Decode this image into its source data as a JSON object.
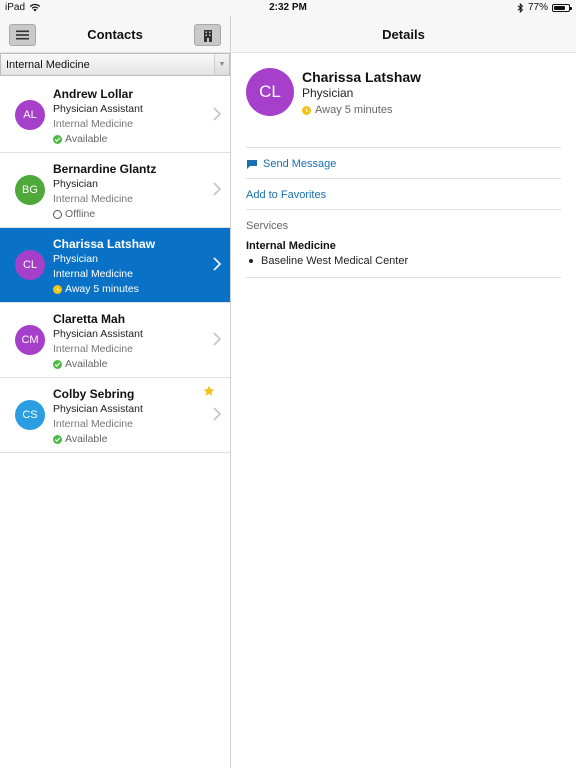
{
  "status_bar": {
    "device": "iPad",
    "time": "2:32 PM",
    "battery": "77%",
    "battery_level": 0.77
  },
  "left": {
    "title": "Contacts",
    "filter_value": "Internal Medicine",
    "contacts": [
      {
        "initials": "AL",
        "name": "Andrew Lollar",
        "role": "Physician Assistant",
        "dept": "Internal Medicine",
        "status": "Available",
        "status_kind": "available",
        "avatar_color": "#a63fc9",
        "favorite": false,
        "selected": false
      },
      {
        "initials": "BG",
        "name": "Bernardine Glantz",
        "role": "Physician",
        "dept": "Internal Medicine",
        "status": "Offline",
        "status_kind": "offline",
        "avatar_color": "#4ea93a",
        "favorite": false,
        "selected": false
      },
      {
        "initials": "CL",
        "name": "Charissa Latshaw",
        "role": "Physician",
        "dept": "Internal Medicine",
        "status": "Away 5 minutes",
        "status_kind": "away",
        "avatar_color": "#a63fc9",
        "favorite": false,
        "selected": true
      },
      {
        "initials": "CM",
        "name": "Claretta Mah",
        "role": "Physician Assistant",
        "dept": "Internal Medicine",
        "status": "Available",
        "status_kind": "available",
        "avatar_color": "#a63fc9",
        "favorite": false,
        "selected": false
      },
      {
        "initials": "CS",
        "name": "Colby Sebring",
        "role": "Physician Assistant",
        "dept": "Internal Medicine",
        "status": "Available",
        "status_kind": "available",
        "avatar_color": "#2a9ee0",
        "favorite": true,
        "selected": false
      }
    ]
  },
  "right": {
    "title": "Details",
    "initials": "CL",
    "avatar_color": "#a63fc9",
    "name": "Charissa Latshaw",
    "role": "Physician",
    "status": "Away 5 minutes",
    "send_message": "Send Message",
    "add_favorites": "Add to Favorites",
    "services_label": "Services",
    "service_group": "Internal Medicine",
    "service_item": "Baseline West Medical Center"
  },
  "colors": {
    "selected_row": "#0a72c6",
    "link": "#1a6fb0",
    "available": "#4cb848",
    "away": "#f2c21b",
    "favorite_star": "#f2c21b"
  }
}
